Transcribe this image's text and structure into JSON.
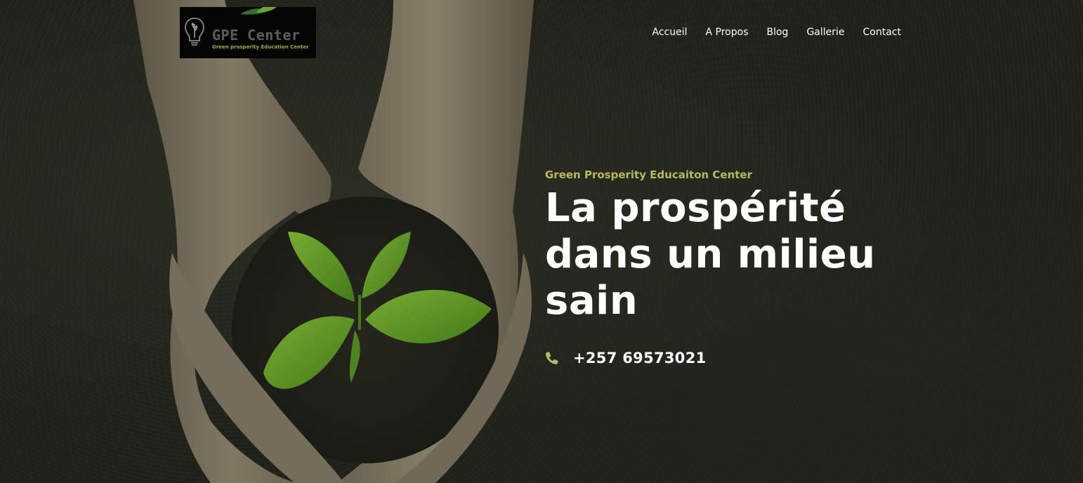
{
  "logo": {
    "title": "GPE Center",
    "subtitle": "Green prosperity Education Center"
  },
  "nav": {
    "items": [
      {
        "label": "Accueil"
      },
      {
        "label": "A Propos"
      },
      {
        "label": "Blog"
      },
      {
        "label": "Gallerie"
      },
      {
        "label": "Contact"
      }
    ]
  },
  "hero": {
    "tagline": "Green Prosperity Educaiton Center",
    "headline_line1": "La prospérité",
    "headline_line2": "dans un milieu",
    "headline_line3": "sain",
    "phone": "+257 69573021",
    "phone_icon": "phone-icon"
  },
  "colors": {
    "accent": "#b7b863",
    "background": "#23251d",
    "leaf": "#6fb52c"
  }
}
